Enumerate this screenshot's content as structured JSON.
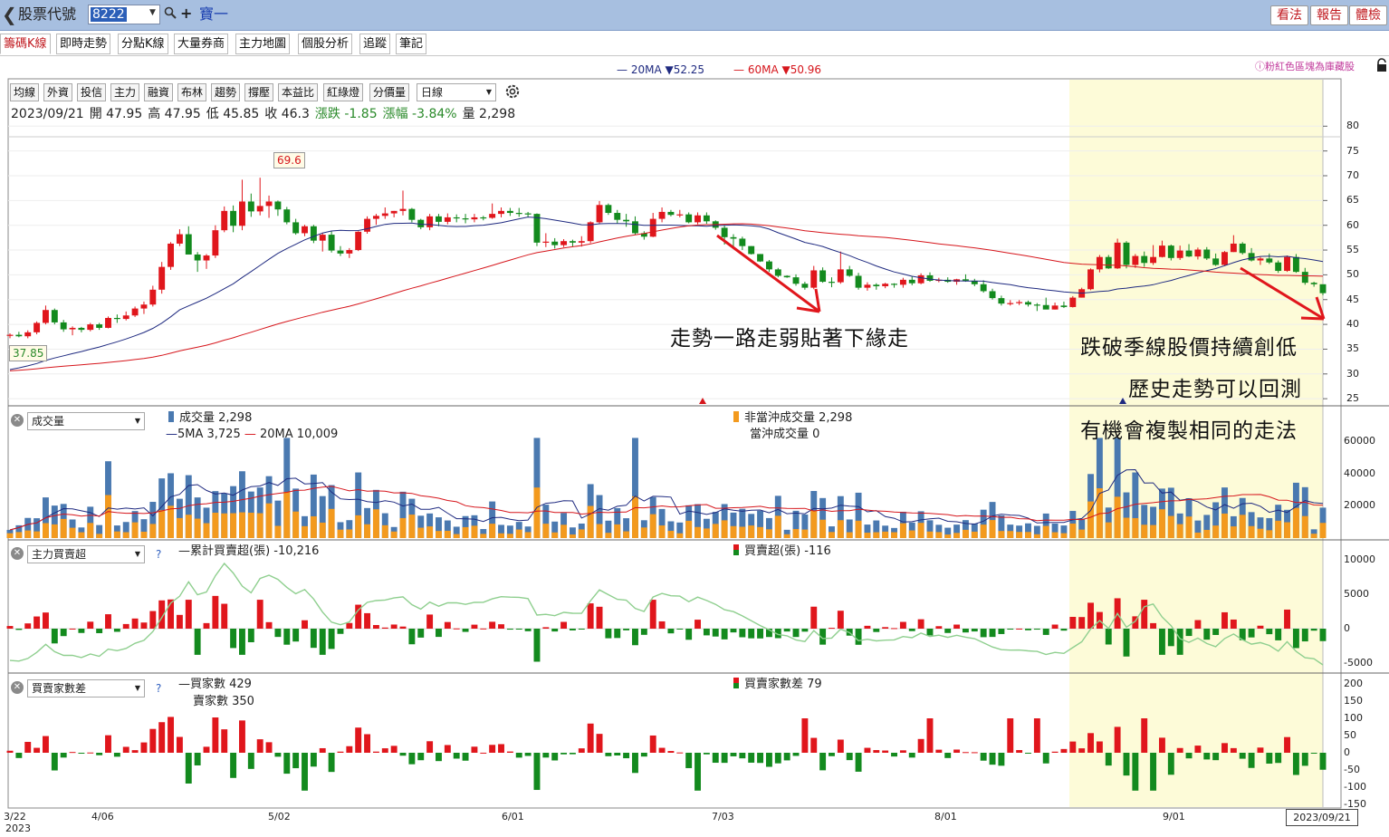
{
  "app": {
    "back_icon": "chevron-left-icon",
    "title": "股票代號",
    "stock_code": "8222",
    "stock_name": "寶一",
    "buttons": [
      "看法",
      "報告",
      "體檢"
    ]
  },
  "tabs": [
    "籌碼K線",
    "即時走勢",
    "分點K線",
    "大量券商",
    "主力地圖",
    "個股分析",
    "追蹤",
    "筆記"
  ],
  "ma_legend": {
    "ma20_label": "20MA ▼52.25",
    "ma60_label": "60MA ▼50.96",
    "pink_note": "ⓘ粉紅色區塊為庫藏股",
    "colors": {
      "ma20": "#1f2a80",
      "ma60": "#d6161c",
      "up": "#e0161c",
      "down": "#138a1e",
      "highlight": "#fdfbd8"
    }
  },
  "toolbar": {
    "buttons": [
      "均線",
      "外資",
      "投信",
      "主力",
      "融資",
      "布林",
      "趨勢",
      "撐壓",
      "本益比",
      "紅綠燈",
      "分價量"
    ],
    "period": "日線",
    "gear_icon": "gear-icon"
  },
  "ohlc": {
    "date": "2023/09/21",
    "open": "開 47.95",
    "high": "高 47.95",
    "low": "低 45.85",
    "close": "收 46.3",
    "change": "漲跌 -1.85",
    "change_pct": "漲幅 -3.84%",
    "volume": "量 2,298"
  },
  "price_panel": {
    "y_ticks": [
      "80",
      "75",
      "70",
      "65",
      "60",
      "55",
      "50",
      "45",
      "40",
      "35",
      "30",
      "25"
    ],
    "high_callout": "69.6",
    "low_callout": "37.85"
  },
  "annotations": {
    "a1": "走勢一路走弱貼著下緣走",
    "a2": "跌破季線股價持續創低",
    "a3": "歷史走勢可以回測",
    "a4": "有機會複製相同的走法"
  },
  "volume_panel": {
    "select": "成交量",
    "legend_volume": "成交量 2,298",
    "legend_5ma": "5MA 3,725",
    "legend_20ma": "20MA 10,009",
    "legend_non_daytrade": "非當沖成交量 2,298",
    "legend_daytrade": "當沖成交量 0",
    "y_ticks": [
      "60000",
      "40000",
      "20000"
    ]
  },
  "main_force_panel": {
    "select": "主力買賣超",
    "help": "?",
    "legend_cum": "累計買賣超(張) -10,216",
    "legend_net": "買賣超(張) -116",
    "y_ticks": [
      "10000",
      "5000",
      "0",
      "-5000"
    ]
  },
  "broker_panel": {
    "select": "買賣家數差",
    "help": "?",
    "legend_buyers": "買家數 429",
    "legend_sellers": "賣家數 350",
    "legend_diff": "買賣家數差 79",
    "y_ticks": [
      "200",
      "150",
      "100",
      "50",
      "0",
      "-50",
      "-100",
      "-150"
    ]
  },
  "x_axis": {
    "labels": [
      "3/22",
      "4/06",
      "5/02",
      "6/01",
      "7/03",
      "8/01",
      "9/01"
    ],
    "year": "2023",
    "current_date": "2023/09/21"
  },
  "chart_data": {
    "type": "candlestick",
    "candles": [
      [
        37.8,
        38.2,
        37.2,
        37.9
      ],
      [
        37.9,
        38.5,
        37.4,
        37.6
      ],
      [
        37.6,
        38.8,
        37.2,
        38.4
      ],
      [
        38.4,
        40.6,
        38.0,
        40.3
      ],
      [
        40.3,
        43.8,
        40.0,
        42.9
      ],
      [
        42.9,
        43.2,
        40.0,
        40.4
      ],
      [
        40.4,
        40.9,
        38.5,
        39.0
      ],
      [
        39.0,
        39.6,
        37.8,
        39.3
      ],
      [
        39.3,
        39.5,
        38.4,
        38.9
      ],
      [
        38.9,
        40.3,
        38.6,
        40.0
      ],
      [
        40.0,
        40.3,
        38.9,
        39.3
      ],
      [
        39.3,
        41.6,
        39.2,
        41.3
      ],
      [
        41.3,
        42.0,
        40.3,
        41.1
      ],
      [
        41.1,
        42.6,
        40.8,
        41.8
      ],
      [
        41.8,
        43.6,
        41.5,
        43.2
      ],
      [
        43.2,
        44.6,
        42.1,
        44.0
      ],
      [
        44.0,
        47.8,
        43.6,
        47.0
      ],
      [
        47.0,
        52.6,
        46.2,
        51.6
      ],
      [
        51.6,
        56.6,
        51.0,
        56.3
      ],
      [
        56.3,
        59.2,
        55.8,
        58.2
      ],
      [
        58.2,
        59.8,
        55.0,
        54.1
      ],
      [
        54.1,
        54.6,
        50.6,
        52.9
      ],
      [
        52.9,
        54.2,
        51.2,
        53.9
      ],
      [
        53.9,
        60.0,
        53.4,
        59.0
      ],
      [
        59.0,
        63.8,
        58.6,
        62.9
      ],
      [
        62.9,
        64.0,
        58.6,
        59.9
      ],
      [
        59.9,
        69.2,
        59.0,
        64.8
      ],
      [
        64.8,
        66.4,
        61.7,
        62.8
      ],
      [
        62.8,
        69.6,
        62.0,
        63.9
      ],
      [
        63.9,
        66.0,
        61.5,
        64.8
      ],
      [
        64.8,
        65.0,
        61.9,
        63.2
      ],
      [
        63.2,
        63.7,
        60.2,
        60.6
      ],
      [
        60.6,
        61.3,
        58.1,
        58.4
      ],
      [
        58.4,
        60.1,
        57.8,
        59.8
      ],
      [
        59.8,
        60.1,
        56.4,
        56.9
      ],
      [
        56.9,
        58.5,
        54.7,
        58.1
      ],
      [
        58.1,
        58.8,
        54.5,
        54.9
      ],
      [
        54.9,
        55.8,
        53.8,
        54.3
      ],
      [
        54.3,
        55.4,
        53.4,
        55.0
      ],
      [
        55.0,
        58.8,
        54.8,
        58.7
      ],
      [
        58.7,
        61.8,
        58.3,
        61.3
      ],
      [
        61.3,
        62.3,
        60.1,
        61.9
      ],
      [
        61.9,
        63.6,
        61.3,
        62.4
      ],
      [
        62.4,
        62.9,
        61.6,
        62.9
      ],
      [
        62.9,
        67.0,
        62.0,
        63.3
      ],
      [
        63.3,
        63.5,
        60.6,
        61.1
      ],
      [
        61.1,
        61.3,
        59.2,
        59.6
      ],
      [
        59.6,
        62.3,
        59.0,
        61.8
      ],
      [
        61.8,
        62.3,
        59.8,
        60.7
      ],
      [
        60.7,
        62.4,
        60.2,
        61.6
      ],
      [
        61.6,
        62.2,
        60.6,
        61.4
      ],
      [
        61.4,
        62.3,
        60.4,
        61.2
      ],
      [
        61.2,
        62.3,
        60.6,
        61.6
      ],
      [
        61.6,
        61.9,
        61.0,
        61.5
      ],
      [
        61.5,
        64.4,
        61.3,
        62.3
      ],
      [
        62.3,
        63.6,
        61.6,
        62.9
      ],
      [
        62.9,
        63.5,
        61.9,
        62.5
      ],
      [
        62.5,
        63.5,
        61.7,
        62.4
      ],
      [
        62.4,
        62.7,
        61.6,
        62.3
      ],
      [
        62.3,
        62.4,
        55.8,
        56.5
      ],
      [
        56.5,
        58.4,
        55.6,
        56.7
      ],
      [
        56.7,
        57.4,
        55.3,
        56.0
      ],
      [
        56.0,
        57.2,
        55.6,
        56.8
      ],
      [
        56.8,
        57.1,
        55.7,
        56.5
      ],
      [
        56.5,
        57.8,
        55.7,
        56.8
      ],
      [
        56.8,
        60.8,
        56.4,
        60.6
      ],
      [
        60.6,
        64.9,
        60.2,
        64.1
      ],
      [
        64.1,
        64.4,
        62.1,
        62.5
      ],
      [
        62.5,
        63.1,
        60.4,
        61.1
      ],
      [
        61.1,
        62.3,
        59.7,
        60.8
      ],
      [
        60.8,
        61.8,
        58.1,
        58.4
      ],
      [
        58.4,
        58.8,
        57.1,
        57.7
      ],
      [
        57.7,
        62.5,
        57.6,
        61.3
      ],
      [
        61.3,
        63.6,
        60.6,
        62.7
      ],
      [
        62.7,
        63.1,
        61.8,
        62.1
      ],
      [
        62.1,
        63.1,
        61.6,
        62.2
      ],
      [
        62.2,
        62.6,
        60.4,
        60.6
      ],
      [
        60.6,
        62.6,
        60.2,
        62.0
      ],
      [
        62.0,
        62.6,
        60.3,
        60.8
      ],
      [
        60.8,
        61.0,
        59.1,
        59.5
      ],
      [
        59.5,
        60.0,
        56.1,
        57.6
      ],
      [
        57.6,
        58.2,
        55.7,
        57.3
      ],
      [
        57.3,
        57.7,
        55.0,
        55.8
      ],
      [
        55.8,
        55.8,
        54.1,
        54.2
      ],
      [
        54.2,
        54.2,
        52.6,
        52.7
      ],
      [
        52.7,
        53.0,
        50.6,
        51.1
      ],
      [
        51.1,
        51.4,
        49.5,
        49.8
      ],
      [
        49.8,
        49.9,
        49.4,
        49.5
      ],
      [
        49.5,
        50.1,
        47.8,
        48.2
      ],
      [
        48.2,
        48.6,
        47.0,
        47.4
      ],
      [
        47.4,
        51.8,
        47.1,
        50.9
      ],
      [
        50.9,
        51.5,
        48.4,
        48.6
      ],
      [
        48.6,
        49.5,
        47.5,
        48.5
      ],
      [
        48.5,
        54.7,
        48.2,
        51.1
      ],
      [
        51.1,
        51.8,
        49.6,
        49.8
      ],
      [
        49.8,
        50.4,
        47.0,
        47.4
      ],
      [
        47.4,
        48.5,
        46.8,
        48.0
      ],
      [
        48.0,
        48.3,
        47.0,
        47.7
      ],
      [
        47.7,
        48.4,
        47.3,
        48.2
      ],
      [
        48.2,
        48.3,
        47.4,
        48.0
      ],
      [
        48.0,
        49.4,
        47.4,
        49.0
      ],
      [
        49.0,
        49.7,
        47.9,
        48.3
      ],
      [
        48.3,
        50.3,
        48.1,
        49.9
      ],
      [
        49.9,
        50.5,
        48.6,
        48.8
      ],
      [
        48.8,
        49.4,
        48.5,
        49.0
      ],
      [
        49.0,
        49.5,
        48.4,
        48.6
      ],
      [
        48.6,
        49.2,
        48.0,
        49.1
      ],
      [
        49.1,
        50.1,
        48.6,
        48.8
      ],
      [
        48.8,
        49.2,
        47.7,
        48.1
      ],
      [
        48.1,
        48.9,
        46.4,
        46.7
      ],
      [
        46.7,
        47.2,
        45.0,
        45.3
      ],
      [
        45.3,
        45.8,
        43.8,
        44.2
      ],
      [
        44.2,
        44.9,
        43.8,
        44.3
      ],
      [
        44.3,
        44.9,
        43.9,
        44.5
      ],
      [
        44.5,
        44.8,
        43.6,
        44.0
      ],
      [
        44.0,
        44.3,
        42.7,
        43.9
      ],
      [
        43.9,
        45.4,
        43.3,
        43.0
      ],
      [
        43.0,
        44.4,
        43.0,
        43.8
      ],
      [
        43.8,
        44.6,
        43.3,
        43.5
      ],
      [
        43.5,
        45.7,
        43.4,
        45.4
      ],
      [
        45.4,
        47.4,
        45.4,
        47.1
      ],
      [
        47.1,
        51.3,
        46.9,
        51.1
      ],
      [
        51.1,
        54.0,
        50.5,
        53.6
      ],
      [
        53.6,
        54.0,
        51.2,
        51.3
      ],
      [
        51.3,
        57.3,
        51.2,
        56.5
      ],
      [
        56.5,
        56.8,
        51.3,
        52.0
      ],
      [
        52.0,
        54.2,
        51.4,
        53.8
      ],
      [
        53.8,
        54.7,
        51.6,
        52.4
      ],
      [
        52.4,
        56.0,
        52.0,
        53.6
      ],
      [
        53.6,
        56.9,
        53.5,
        55.9
      ],
      [
        55.9,
        56.1,
        52.9,
        53.4
      ],
      [
        53.4,
        55.9,
        53.0,
        54.9
      ],
      [
        54.9,
        56.2,
        53.6,
        53.7
      ],
      [
        53.7,
        55.5,
        53.1,
        55.1
      ],
      [
        55.1,
        55.6,
        53.0,
        53.3
      ],
      [
        53.3,
        54.3,
        51.8,
        52.0
      ],
      [
        52.0,
        54.8,
        51.8,
        54.6
      ],
      [
        54.6,
        58.0,
        54.6,
        56.3
      ],
      [
        56.3,
        56.6,
        54.1,
        54.4
      ],
      [
        54.4,
        55.4,
        52.7,
        52.9
      ],
      [
        52.9,
        53.6,
        52.0,
        53.3
      ],
      [
        53.3,
        54.3,
        52.2,
        52.5
      ],
      [
        52.5,
        52.9,
        50.4,
        50.8
      ],
      [
        50.8,
        53.9,
        50.6,
        53.6
      ],
      [
        53.6,
        54.2,
        50.4,
        50.6
      ],
      [
        50.6,
        51.4,
        48.0,
        48.4
      ],
      [
        48.4,
        48.6,
        47.6,
        48.1
      ],
      [
        48.1,
        48.0,
        45.9,
        46.3
      ]
    ]
  }
}
